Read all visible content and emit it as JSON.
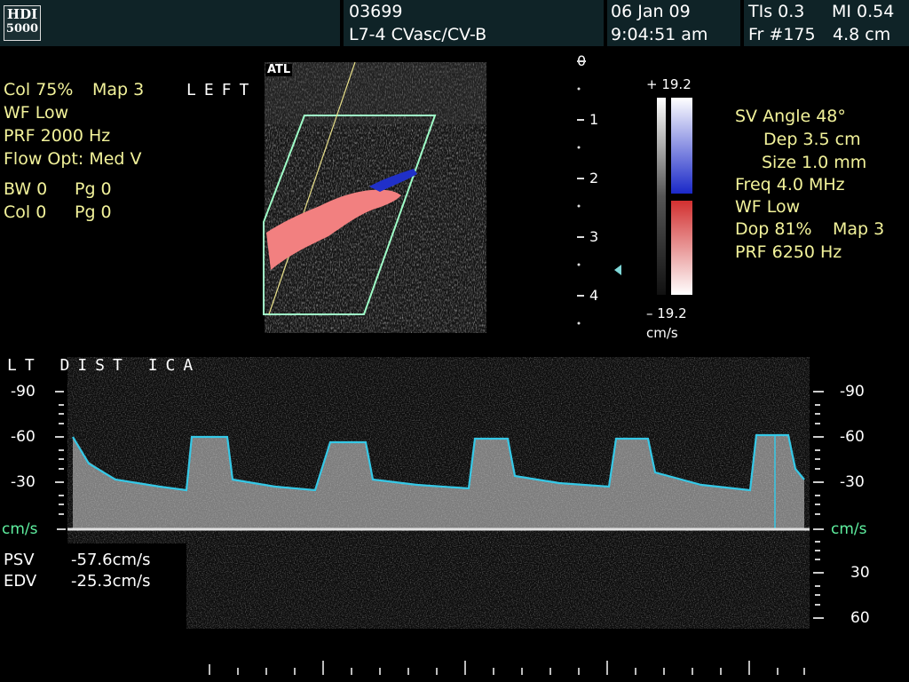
{
  "header": {
    "logo_top": "HDI",
    "logo_bottom": "5000",
    "patient_id": "03699",
    "transducer": "L7-4 CVasc/CV-B",
    "date": "06 Jan 09",
    "time": "9:04:51 am",
    "tis": "TIs 0.3",
    "mi": "MI 0.54",
    "frame": "Fr #175",
    "depth": "4.8 cm"
  },
  "left_params": {
    "col": "Col 75%",
    "map": "Map 3",
    "side": "LEFT",
    "wf": "WF Low",
    "prf": "PRF 2000  Hz",
    "flow_opt": "Flow Opt: Med V",
    "bw": "BW 0",
    "pg1": "Pg 0",
    "col2": "Col 0",
    "pg2": "Pg 0"
  },
  "image": {
    "atl_mark": "ATL",
    "depth_ticks": [
      "0",
      "1",
      "2",
      "3",
      "4"
    ]
  },
  "color_bar": {
    "max": "+ 19.2",
    "min": "– 19.2",
    "unit": "cm/s"
  },
  "right_params": {
    "sv_angle": "SV Angle 48°",
    "dep": "Dep 3.5  cm",
    "size": "Size 1.0  mm",
    "freq": "Freq 4.0  MHz",
    "wf": "WF Low",
    "dop": "Dop 81%",
    "map": "Map 3",
    "prf": "PRF 6250  Hz"
  },
  "spectral": {
    "label": "LT DIST ICA",
    "unit": "cm/s",
    "left_scale": [
      "-90",
      "-60",
      "-30"
    ],
    "right_scale": [
      "-90",
      "-60",
      "-30",
      "30",
      "60"
    ]
  },
  "measurements": {
    "psv_label": "PSV",
    "psv_value": "-57.6cm/s",
    "edv_label": "EDV",
    "edv_value": "-25.3cm/s"
  },
  "colors": {
    "header_bg": "#0f2327",
    "param_text": "#f2f29a",
    "envelope": "#35c8e6",
    "roi_box": "#9fffc8",
    "baseline": "#e0e0e0",
    "flow_red": "#f07878",
    "flow_blue": "#2030c0"
  }
}
